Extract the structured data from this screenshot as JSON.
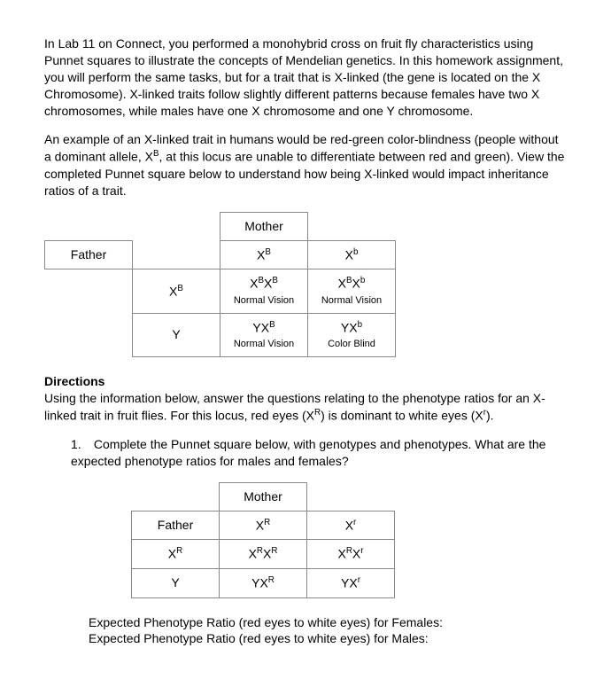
{
  "intro1": "In Lab 11 on Connect, you performed a monohybrid cross on fruit fly characteristics using Punnet squares to illustrate the concepts of Mendelian genetics. In this homework assignment, you will perform the same tasks, but for a trait that is X-linked (the gene is located on the X Chromosome). X-linked traits follow slightly different patterns because females have two X chromosomes, while males have one X chromosome and one Y chromosome.",
  "intro2a": "An example of an X-linked trait in humans would be red-green color-blindness (people without a dominant allele, X",
  "intro2sup": "B",
  "intro2b": ", at this locus are unable to differentiate between red and green). View the completed Punnet square below to understand how being X-linked would impact inheritance ratios of a trait.",
  "table1": {
    "mother": "Mother",
    "father": "Father",
    "colA": "X",
    "colA_sup": "B",
    "colB": "X",
    "colB_sup": "b",
    "rowA": "X",
    "rowA_sup": "B",
    "rowB": "Y",
    "c11": "X",
    "c11s1": "B",
    "c11b": "X",
    "c11s2": "B",
    "c11p": "Normal Vision",
    "c12": "X",
    "c12s1": "B",
    "c12b": "X",
    "c12s2": "b",
    "c12p": "Normal Vision",
    "c21": "YX",
    "c21s": "B",
    "c21p": "Normal Vision",
    "c22": "YX",
    "c22s": "b",
    "c22p": "Color Blind"
  },
  "dir_head": "Directions",
  "dir_body_a": "Using the information below, answer the questions relating to the phenotype ratios for an X-linked trait in fruit flies. For this locus, red eyes (X",
  "dir_sup1": "R",
  "dir_body_b": ") is dominant to white eyes (X",
  "dir_sup2": "r",
  "dir_body_c": ").",
  "q1_num": "1.",
  "q1_text": "Complete the Punnet square below, with genotypes and phenotypes. What are the expected phenotype ratios for males and females?",
  "table2": {
    "mother": "Mother",
    "father": "Father",
    "colA": "X",
    "colA_sup": "R",
    "colB": "X",
    "colB_sup": "r",
    "rowA": "X",
    "rowA_sup": "R",
    "rowB": "Y",
    "c11a": "X",
    "c11s1": "R",
    "c11b": "X",
    "c11s2": "R",
    "c12a": "X",
    "c12s1": "R",
    "c12b": "X",
    "c12s2": "r",
    "c21": "YX",
    "c21s": "R",
    "c22": "YX",
    "c22s": "r"
  },
  "ratio1": "Expected Phenotype Ratio (red eyes to white eyes) for Females:",
  "ratio2": "Expected Phenotype Ratio (red eyes to white eyes) for Males:"
}
